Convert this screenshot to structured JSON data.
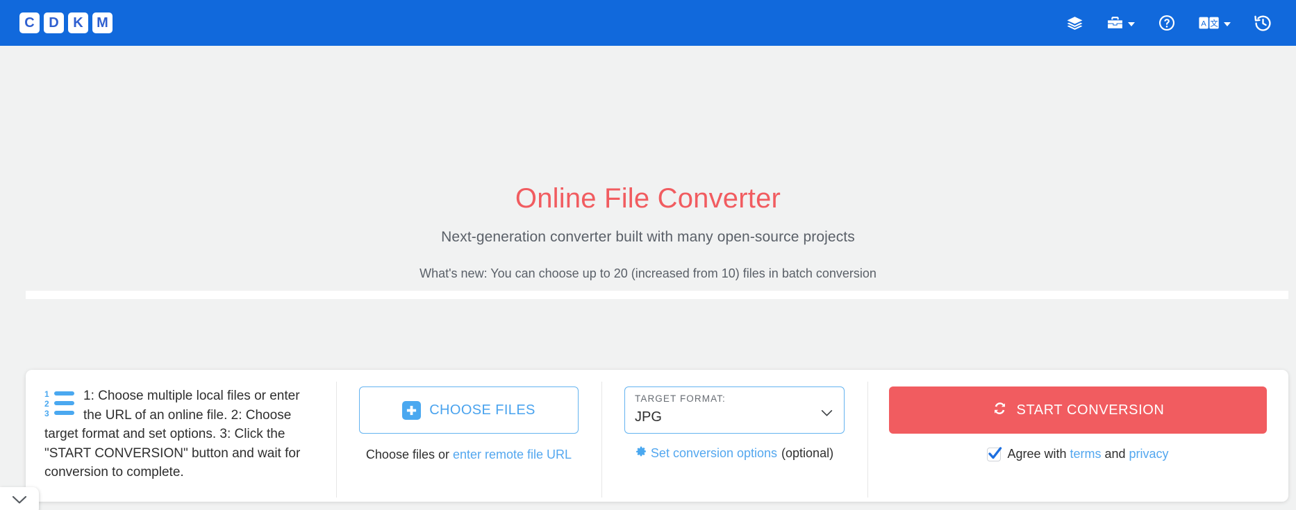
{
  "header": {
    "brand_tiles": [
      "C",
      "D",
      "K",
      "M"
    ],
    "icons": [
      {
        "name": "layers-icon",
        "label": "",
        "has_caret": false
      },
      {
        "name": "toolbox-icon",
        "label": "",
        "has_caret": true
      },
      {
        "name": "question-circle-icon",
        "label": "",
        "has_caret": false
      },
      {
        "name": "language-translate-icon",
        "label": "",
        "has_caret": true
      },
      {
        "name": "history-clock-icon",
        "label": "",
        "has_caret": false
      }
    ],
    "background_color": "#1169dc"
  },
  "hero": {
    "title": "Online File Converter",
    "title_color": "#f15c60",
    "subtitle": "Next-generation converter built with many open-source projects",
    "whats_new": "What's new: You can choose up to 20 (increased from 10) files in batch conversion"
  },
  "card": {
    "instructions": {
      "icon": "ordered-list-icon",
      "text": "1: Choose multiple local files or enter the URL of an online file. 2: Choose target format and set options. 3: Click the \"START CONVERSION\" button and wait for conversion to complete."
    },
    "choose": {
      "button_label": "CHOOSE FILES",
      "icon": "plus-square-icon",
      "hint_prefix": "Choose files or ",
      "hint_link": "enter remote file URL"
    },
    "target": {
      "label": "TARGET FORMAT:",
      "value": "JPG",
      "caret_icon": "chevron-down-icon",
      "options_icon": "gear-icon",
      "options_link": "Set conversion options",
      "options_suffix": " (optional)"
    },
    "start": {
      "button_label": "START CONVERSION",
      "icon": "sync-refresh-icon",
      "button_color": "#f15c60",
      "agree_prefix": "Agree with ",
      "terms_link": "terms",
      "agree_middle": " and ",
      "privacy_link": "privacy",
      "checked": true
    }
  },
  "collapse_tab": {
    "icon": "chevron-down-icon"
  }
}
